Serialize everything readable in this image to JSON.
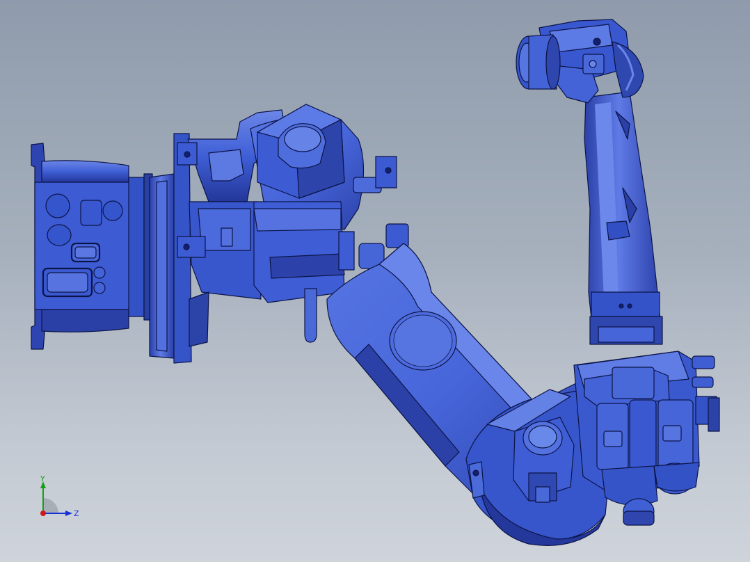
{
  "viewport": {
    "background_top": "#8f9bac",
    "background_bottom": "#cfd4db"
  },
  "model": {
    "body_color": "#3f5fd6",
    "shade_color": "#23358f",
    "edge_color": "#0c1447",
    "highlight_color": "#7c95ee"
  },
  "triad": {
    "x_color": "#d01818",
    "y_color": "#18a018",
    "z_color": "#1830d8",
    "y_label": "Y",
    "z_label": "Z"
  }
}
